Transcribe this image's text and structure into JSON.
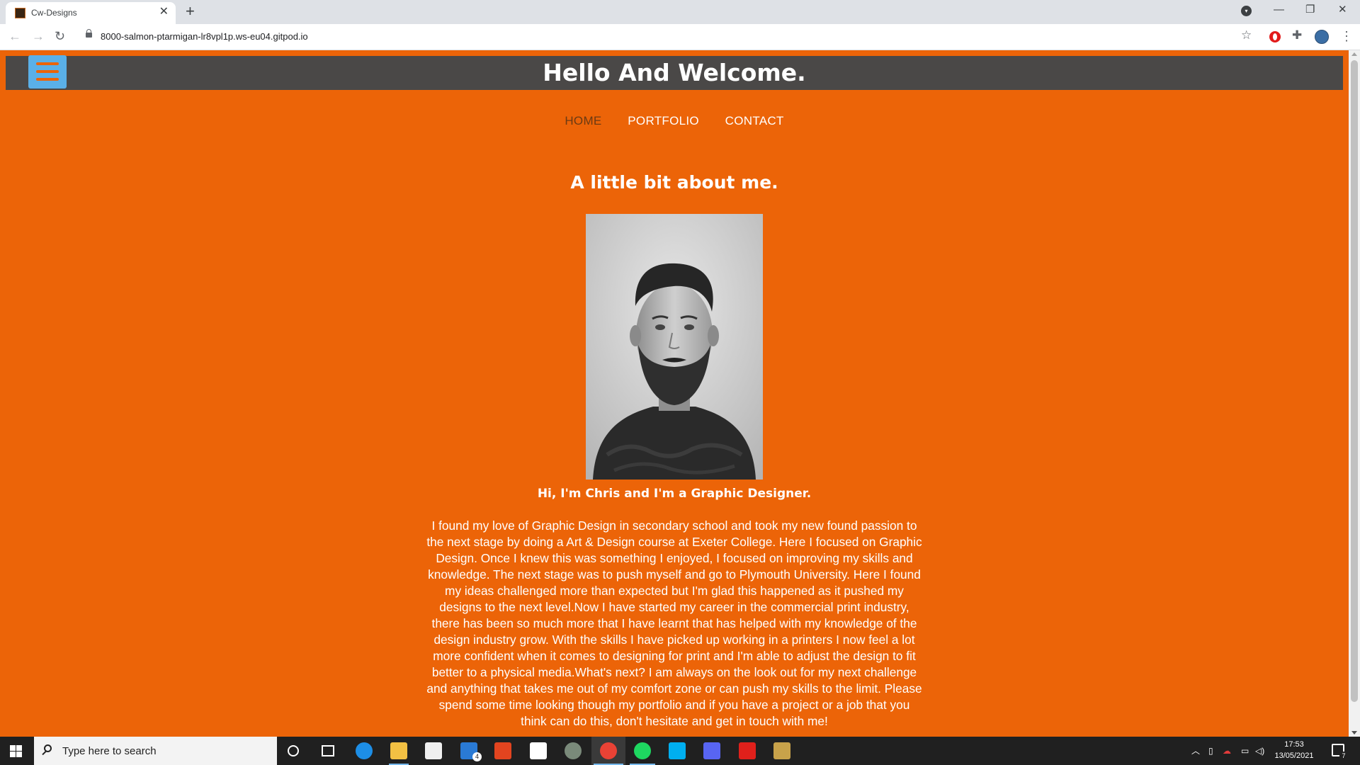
{
  "browser": {
    "tab": {
      "title": "Cw-Designs"
    },
    "new_tab_symbol": "+",
    "url": "8000-salmon-ptarmigan-lr8vpl1p.ws-eu04.gitpod.io",
    "icons": [
      "back-arrow-icon",
      "forward-arrow-icon",
      "reload-icon",
      "lock-icon",
      "star-icon",
      "opera-extension-icon",
      "puzzle-extension-icon",
      "profile-avatar",
      "menu-dots-icon",
      "minimize-icon",
      "maximize-icon",
      "close-icon"
    ]
  },
  "site": {
    "title": "Hello And Welcome.",
    "nav": [
      {
        "label": "HOME",
        "active": true
      },
      {
        "label": "PORTFOLIO",
        "active": false
      },
      {
        "label": "CONTACT",
        "active": false
      }
    ],
    "about_heading": "A little bit about me.",
    "intro": "Hi, I'm Chris and I'm a Graphic Designer.",
    "bio": "I found my love of Graphic Design in secondary school and took my new found passion to the next stage by doing a Art & Design course at Exeter College. Here I focused on Graphic Design. Once I knew this was something I enjoyed, I focused on improving my skills and knowledge. The next stage was to push myself and go to Plymouth University. Here I found my ideas challenged more than expected but I'm glad this happened as it pushed my designs to the next level.Now I have started my career in the commercial print industry, there has been so much more that I have learnt that has helped with my knowledge of the design industry grow. With the skills I have picked up working in a printers I now feel a lot more confident when it comes to designing for print and I'm able to adjust the design to fit better to a physical media.What's next? I am always on the look out for my next challenge and anything that takes me out of my comfort zone or can push my skills to the limit. Please spend some time looking though my portfolio and if you have a project or a job that you think can do this, don't hesitate and get in touch with me!"
  },
  "colors": {
    "page_background": "#ec6408",
    "header_background": "#4a4847",
    "hamburger_background": "#5ab0e8",
    "active_nav": "#6b3a13"
  },
  "taskbar": {
    "search_placeholder": "Type here to search",
    "time": "17:53",
    "date": "13/05/2021",
    "mail_badge": "4",
    "notification_count": "7",
    "apps": [
      "cortana-icon",
      "task-view-icon",
      "edge-icon",
      "file-explorer-icon",
      "store-icon",
      "mail-icon",
      "office-icon",
      "capcut-icon",
      "app-icon",
      "chrome-icon",
      "spotify-icon",
      "skype-icon",
      "discord-icon",
      "acrobat-icon",
      "league-icon"
    ]
  }
}
